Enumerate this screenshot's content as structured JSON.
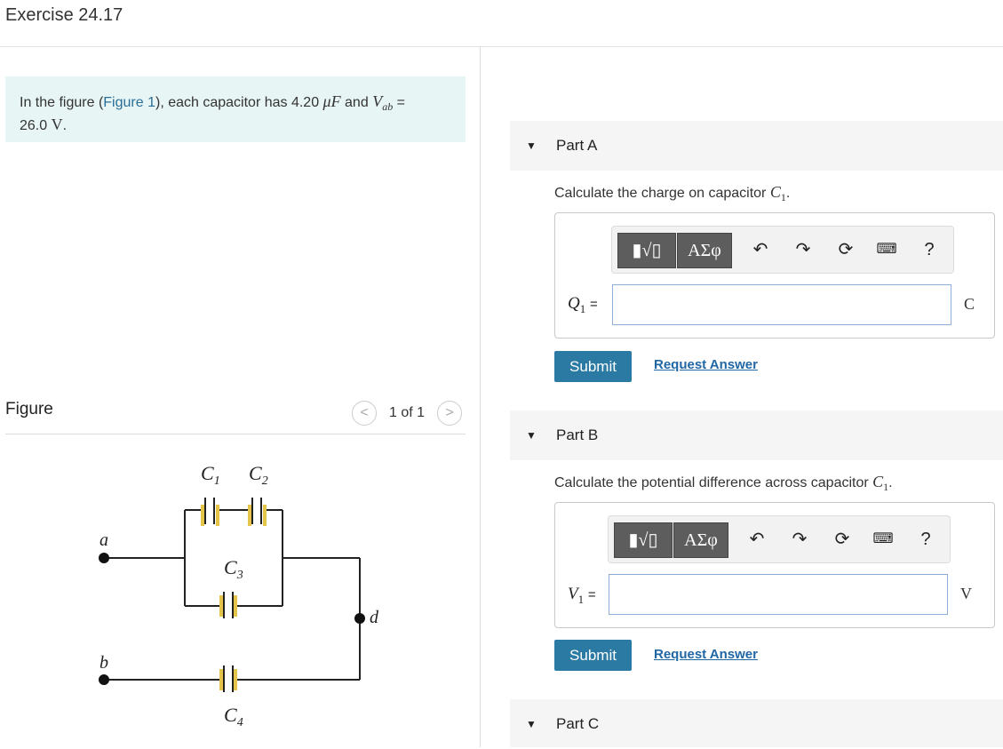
{
  "header": {
    "title": "Exercise 24.17"
  },
  "problem": {
    "text_before": "In the figure (",
    "link": "Figure 1",
    "text_mid": "), each capacitor has 4.20",
    "capacitance_unit": "μF",
    "text_and": "and",
    "var": "V",
    "var_sub": "ab",
    "equals": "=",
    "voltage": "26.0",
    "voltage_unit": "V",
    "period": "."
  },
  "figure": {
    "label": "Figure",
    "pager": "1 of 1",
    "prev": "<",
    "next": ">",
    "labels": {
      "C1": "C",
      "C1_sub": "1",
      "C2": "C",
      "C2_sub": "2",
      "C3": "C",
      "C3_sub": "3",
      "C4": "C",
      "C4_sub": "4",
      "a": "a",
      "b": "b",
      "d": "d"
    }
  },
  "parts": [
    {
      "title": "Part A",
      "prompt": "Calculate the charge on capacitor",
      "prompt_var": "C",
      "prompt_sub": "1",
      "prompt_end": ".",
      "var": "Q",
      "var_sub": "1",
      "equals": "=",
      "value": "",
      "unit": "C",
      "submit": "Submit",
      "request": "Request Answer"
    },
    {
      "title": "Part B",
      "prompt": "Calculate the potential difference across capacitor",
      "prompt_var": "C",
      "prompt_sub": "1",
      "prompt_end": ".",
      "var": "V",
      "var_sub": "1",
      "equals": "=",
      "value": "",
      "unit": "V",
      "submit": "Submit",
      "request": "Request Answer"
    },
    {
      "title": "Part C"
    }
  ],
  "toolbar": {
    "greek": "ΑΣφ",
    "help": "?",
    "icons": [
      "templates-icon",
      "greek-symbols-icon",
      "undo-icon",
      "redo-icon",
      "reset-icon",
      "keyboard-icon",
      "help-icon"
    ]
  }
}
